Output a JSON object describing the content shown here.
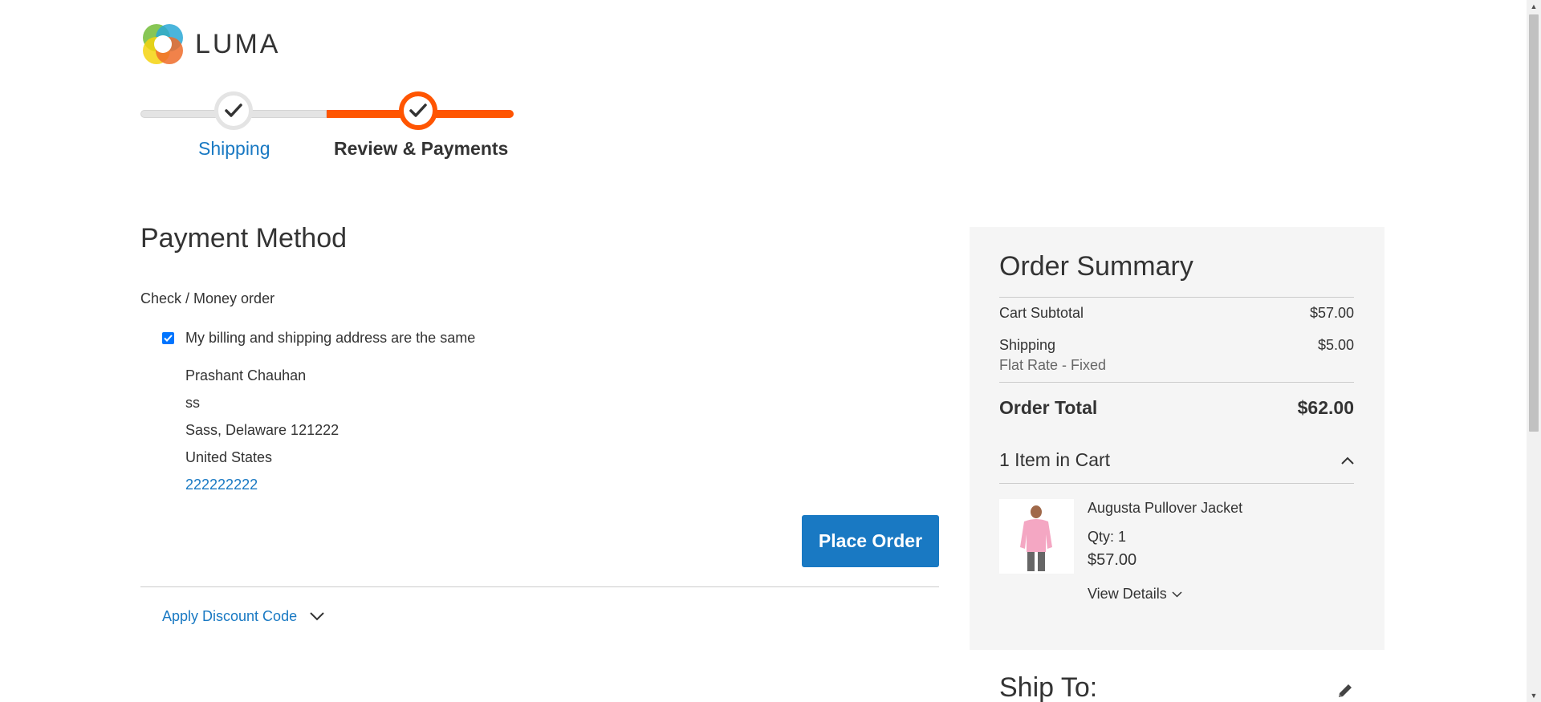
{
  "logo": {
    "text": "LUMA",
    "icon": "luma-logo-icon"
  },
  "progress": {
    "steps": [
      {
        "label": "Shipping",
        "state": "complete"
      },
      {
        "label": "Review & Payments",
        "state": "active"
      }
    ],
    "active_color": "#ff5501"
  },
  "payment": {
    "title": "Payment Method",
    "method": "Check / Money order",
    "billing_same_label": "My billing and shipping address are the same",
    "billing_same_checked": true,
    "address": {
      "name": "Prashant Chauhan",
      "street": "ss",
      "city_line": "Sass, Delaware 121222",
      "country": "United States",
      "phone": "222222222"
    },
    "place_order_label": "Place Order",
    "discount_label": "Apply Discount Code"
  },
  "summary": {
    "title": "Order Summary",
    "rows": [
      {
        "label": "Cart Subtotal",
        "value": "$57.00"
      },
      {
        "label": "Shipping",
        "value": "$5.00",
        "sub": "Flat Rate - Fixed"
      }
    ],
    "total_label": "Order Total",
    "total_value": "$62.00",
    "items_header": "1 Item in Cart",
    "items": [
      {
        "name": "Augusta Pullover Jacket",
        "qty": "Qty: 1",
        "price": "$57.00",
        "details_label": "View Details"
      }
    ]
  },
  "ship_to": {
    "title": "Ship To:"
  },
  "colors": {
    "link": "#1979c3",
    "button": "#1979c3",
    "accent": "#ff5501"
  }
}
